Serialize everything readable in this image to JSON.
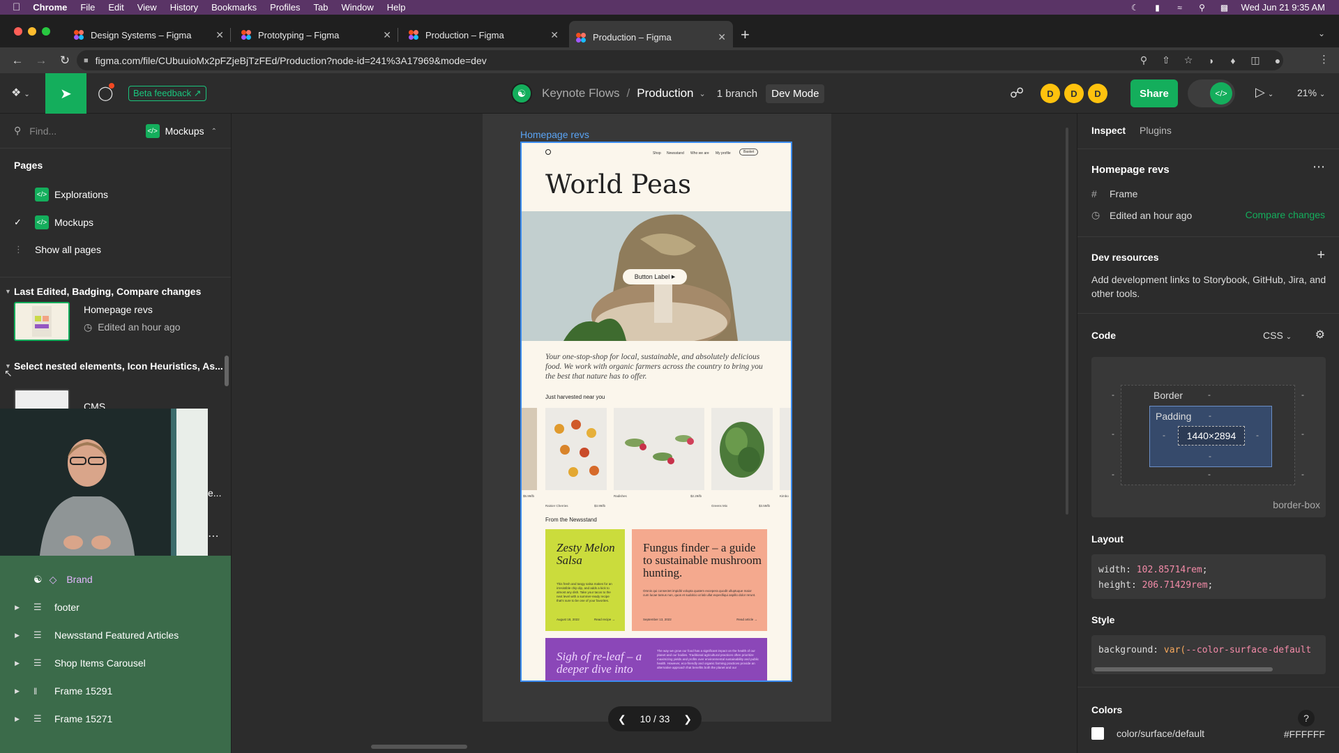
{
  "macos": {
    "app": "Chrome",
    "menus": [
      "File",
      "Edit",
      "View",
      "History",
      "Bookmarks",
      "Profiles",
      "Tab",
      "Window",
      "Help"
    ],
    "clock": "Wed Jun 21  9:35 AM"
  },
  "browser": {
    "tabs": [
      {
        "title": "Design Systems – Figma"
      },
      {
        "title": "Prototyping – Figma"
      },
      {
        "title": "Production – Figma"
      },
      {
        "title": "Production – Figma"
      }
    ],
    "url": "figma.com/file/CUbuuioMx2pFZjeBjTzFEd/Production?node-id=241%3A17969&mode=dev"
  },
  "toolbar": {
    "beta_feedback": "Beta feedback",
    "project": "Keynote Flows",
    "file": "Production",
    "branch": "1 branch",
    "dev_mode": "Dev Mode",
    "avatars": [
      "D",
      "D",
      "D"
    ],
    "share": "Share",
    "zoom": "21%"
  },
  "left": {
    "search_placeholder": "Find...",
    "current_page": "Mockups",
    "pages_title": "Pages",
    "pages": [
      {
        "name": "Explorations"
      },
      {
        "name": "Mockups"
      }
    ],
    "show_all": "Show all pages",
    "section1": "Last Edited, Badging, Compare changes",
    "item1_title": "Homepage revs",
    "item1_meta": "Edited an hour ago",
    "section2": "Select nested elements, Icon Heuristics, As...",
    "item2_title": "CMS",
    "item2_partial": "e...",
    "layers": [
      {
        "name": "Brand",
        "icon": "component-icon"
      },
      {
        "name": "footer",
        "icon": "text-layer-icon"
      },
      {
        "name": "Newsstand Featured Articles",
        "icon": "text-layer-icon"
      },
      {
        "name": "Shop Items Carousel",
        "icon": "text-layer-icon"
      },
      {
        "name": "Frame 15291",
        "icon": "columns-icon"
      },
      {
        "name": "Frame 15271",
        "icon": "text-layer-icon"
      }
    ]
  },
  "canvas": {
    "frame_label": "Homepage revs",
    "pager": "10 / 33",
    "mockup": {
      "nav": [
        "Shop",
        "Newsstand",
        "Who we are",
        "My profile"
      ],
      "basket": "Basket",
      "hero": "World Peas",
      "button": "Button Label",
      "copy": "Your one-stop-shop for local, sustainable, and absolutely delicious food. We work with organic farmers across the country to bring you the best that nature has to offer.",
      "harvested": "Just harvested near you",
      "products": [
        {
          "name": "Rainier Cherries",
          "price": "$3.99/lb"
        },
        {
          "name": "Radishes",
          "price": "$2.29/lb"
        },
        {
          "name": "Greens Mix",
          "price": "$3.59/lb"
        }
      ],
      "left_price": "$5.99/lb",
      "right_name": "Kimbo",
      "newsstand": "From the Newsstand",
      "card1_title": "Zesty Melon Salsa",
      "card1_body": "This fresh and tangy salsa makes for an irresistible chip dip, and adds a kick to almost any dish. Take your tacos to the next level with a summer-ready recipe that's sure to be one of your favorites.",
      "card1_date": "August 18, 2022",
      "card1_read": "Read recipe →",
      "card2_title": "Fungus finder – a guide to sustainable mushroom hunting.",
      "card2_body": "Omnis qui consectet impiditi volupta quatem excepera quodit ulluptuque maior cum lucae tamus non, quos et sudolcio ut lab ullut expeclliqui aspillo dolor rerunt.",
      "card2_date": "September 13, 2022",
      "card2_read": "Read article →",
      "card3_title": "Sigh of re-leaf – a deeper dive into",
      "card3_body": "The way we grow our food has a significant impact on the health of our planet and our bodies. Traditional agricultural practices often prioritize maximizing yields and profits over environmental sustainability and public health. However, eco-friendly and organic farming practices provide an alternative approach that benefits both the planet and our"
    }
  },
  "right": {
    "tabs": [
      "Inspect",
      "Plugins"
    ],
    "title": "Homepage revs",
    "type": "Frame",
    "edited": "Edited an hour ago",
    "compare": "Compare changes",
    "dev_resources": "Dev resources",
    "dev_resources_desc": "Add development links to Storybook, GitHub, Jira, and other tools.",
    "code": "Code",
    "code_lang": "CSS",
    "border_label": "Border",
    "padding_label": "Padding",
    "size": "1440×2894",
    "dash": "-",
    "box_sizing": "border-box",
    "layout": "Layout",
    "layout_width_prop": "width:",
    "layout_width_val": "102.85714rem",
    "layout_height_prop": "height:",
    "layout_height_val": "206.71429rem",
    "style": "Style",
    "style_prop": "background:",
    "style_fn": "var(",
    "style_var": "--color-surface-default",
    "colors": "Colors",
    "color_name": "color/surface/default",
    "color_hex": "#FFFFFF"
  }
}
